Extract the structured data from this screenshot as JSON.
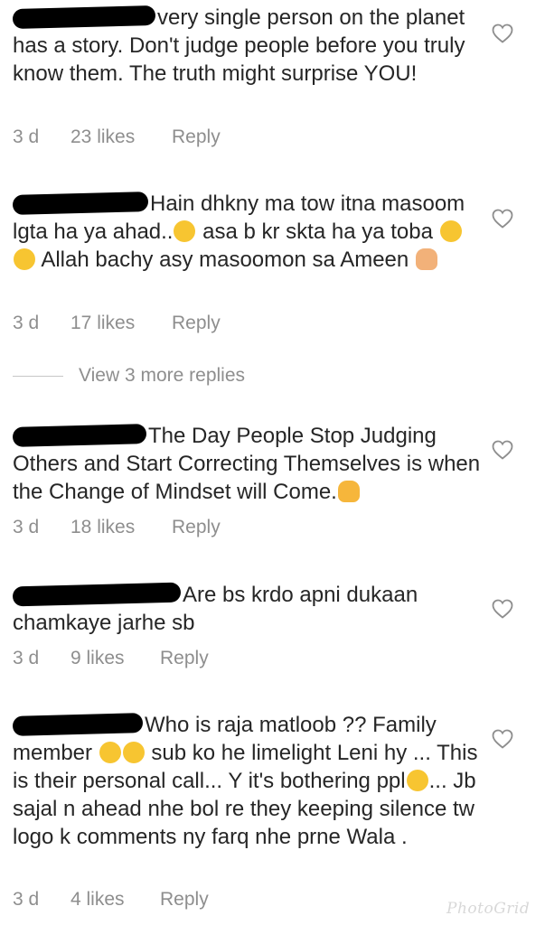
{
  "comments": [
    {
      "text": "very single person on the planet has a story. Don't judge people before you truly know them. The truth might surprise YOU!",
      "time": "3 d",
      "likes": "23 likes",
      "reply": "Reply"
    },
    {
      "text_a": "Hain dhkny ma tow itna masoom lgta ha ya ahad..",
      "text_b": "asa b kr skta ha ya toba",
      "text_c": "Allah bachy asy masoomon sa Ameen",
      "time": "3 d",
      "likes": "17 likes",
      "reply": "Reply"
    },
    {
      "text": "The Day People Stop Judging Others and Start Correcting Themselves is when the Change of Mindset will Come.",
      "time": "3 d",
      "likes": "18 likes",
      "reply": "Reply"
    },
    {
      "text": "Are bs krdo apni dukaan chamkaye jarhe sb",
      "time": "3 d",
      "likes": "9 likes",
      "reply": "Reply"
    },
    {
      "text_a": "Who is raja matloob ?? Family member",
      "text_b": "sub ko he limelight Leni hy ... This is their personal call... Y it's bothering ppl",
      "text_c": "... Jb sajal n ahead nhe bol re they keeping silence tw logo k comments ny farq nhe prne Wala .",
      "time": "3 d",
      "likes": "4 likes",
      "reply": "Reply"
    }
  ],
  "view_more": "View 3 more replies",
  "watermark": "PhotoGrid",
  "icons": {
    "like": "heart-outline-icon",
    "emoji_hushed": "hushed-face-emoji",
    "emoji_tongue": "squinting-tongue-face-emoji",
    "emoji_eyeroll": "eye-roll-face-emoji",
    "emoji_pray": "open-hands-emoji",
    "emoji_raised": "raising-hands-emoji",
    "emoji_joy": "tears-of-joy-emoji",
    "emoji_smirk": "smirking-face-emoji"
  },
  "colors": {
    "text": "#262626",
    "meta": "#8e8e8e",
    "redaction": "#000000"
  }
}
